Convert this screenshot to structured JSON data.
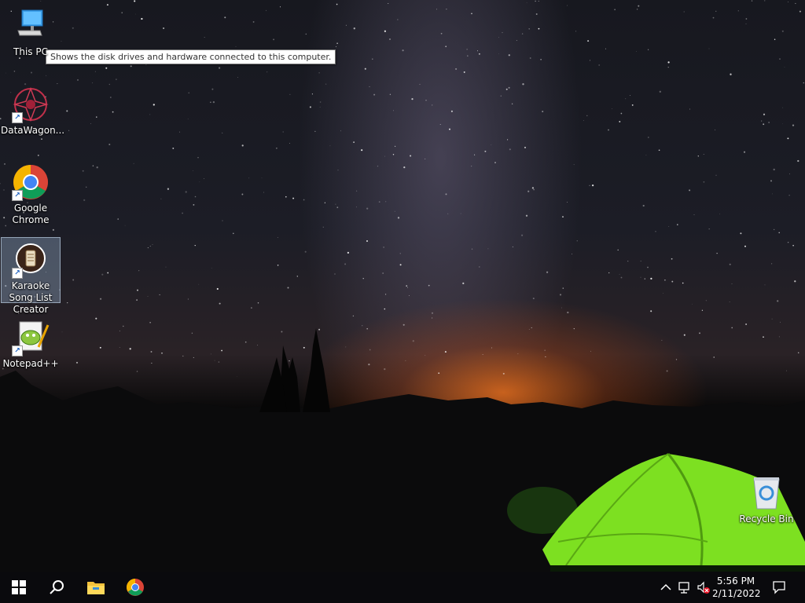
{
  "desktop": {
    "icons": [
      {
        "label": "This PC",
        "icon": "computer-icon"
      },
      {
        "label": "DataWagon...",
        "icon": "datawagon-icon"
      },
      {
        "label": "Google Chrome",
        "icon": "chrome-icon"
      },
      {
        "label": "Karaoke Song List Creator",
        "icon": "karaoke-icon"
      },
      {
        "label": "Notepad++",
        "icon": "notepadpp-icon"
      },
      {
        "label": "Recycle Bin",
        "icon": "recycle-bin-icon"
      }
    ],
    "tooltip": "Shows the disk drives and hardware connected to this computer."
  },
  "taskbar": {
    "start": "windows-start-icon",
    "search": "search-icon",
    "pinned": [
      "file-explorer-icon",
      "chrome-icon"
    ],
    "tray": {
      "time": "5:56 PM",
      "date": "2/11/2022",
      "icons": [
        "chevron-up-icon",
        "network-icon",
        "volume-muted-icon",
        "action-center-icon"
      ]
    }
  },
  "colors": {
    "taskbar": "#0a0a0d",
    "selection": "#a0bedc",
    "tent": "#7de021"
  }
}
